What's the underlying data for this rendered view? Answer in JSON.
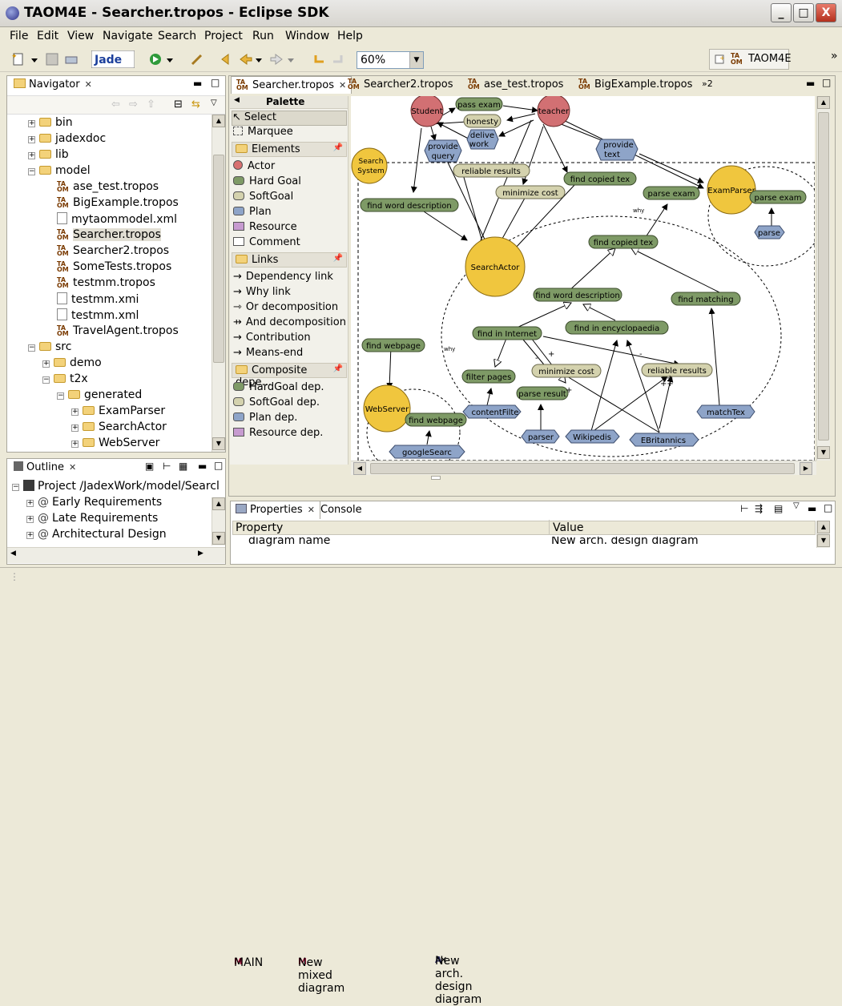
{
  "window": {
    "title": "TAOM4E - Searcher.tropos - Eclipse SDK",
    "min": "_",
    "max": "□",
    "close": "X"
  },
  "menu": [
    "File",
    "Edit",
    "View",
    "Navigate",
    "Search",
    "Project",
    "Run",
    "Window",
    "Help"
  ],
  "toolbar": {
    "zoom": "60%",
    "perspective": "TAOM4E",
    "more": "»"
  },
  "navigator": {
    "title": "Navigator",
    "items": [
      "bin",
      "jadexdoc",
      "lib",
      "model",
      "ase_test.tropos",
      "BigExample.tropos",
      "mytaommodel.xml",
      "Searcher.tropos",
      "Searcher2.tropos",
      "SomeTests.tropos",
      "testmm.tropos",
      "testmm.xmi",
      "testmm.xml",
      "TravelAgent.tropos",
      "src",
      "demo",
      "t2x",
      "generated",
      "ExamParser",
      "SearchActor",
      "WebServer"
    ]
  },
  "outline": {
    "title": "Outline",
    "items": [
      "Project /JadexWork/model/Searcl",
      "Early Requirements",
      "Late Requirements",
      "Architectural Design"
    ]
  },
  "editor_tabs": [
    "Searcher.tropos",
    "Searcher2.tropos",
    "ase_test.tropos",
    "BigExample.tropos",
    "»2"
  ],
  "palette": {
    "title": "Palette",
    "tools": [
      "Select",
      "Marquee"
    ],
    "sections": [
      {
        "name": "Elements",
        "items": [
          "Actor",
          "Hard Goal",
          "SoftGoal",
          "Plan",
          "Resource",
          "Comment"
        ]
      },
      {
        "name": "Links",
        "items": [
          "Dependency link",
          "Why link",
          "Or decomposition",
          "And decomposition",
          "Contribution",
          "Means-end"
        ]
      },
      {
        "name": "Composite depe...",
        "items": [
          "HardGoal dep.",
          "SoftGoal dep.",
          "Plan dep.",
          "Resource dep."
        ]
      }
    ]
  },
  "diagram": {
    "actors": [
      "Student",
      "teacher",
      "Search System",
      "SearchActor",
      "ExamParser",
      "WebServer"
    ],
    "goals": [
      "pass exam",
      "find word description",
      "find copied tex",
      "parse exam",
      "find copied tex",
      "find word description",
      "find matching",
      "find in Internet",
      "find in encyclopaedia",
      "find webpage",
      "filter pages",
      "parse result",
      "find webpage",
      "parse exam"
    ],
    "softgoals": [
      "honesty",
      "reliable results",
      "minimize cost",
      "minimize cost",
      "reliable results"
    ],
    "plans": [
      "provide query",
      "deliver work",
      "provide text",
      "parse",
      "contentFilte",
      "parser",
      "Wikipedia",
      "EBritannica",
      "matchTex",
      "googleSearc"
    ],
    "labels": [
      "why",
      "why",
      "-",
      "+",
      "+",
      "++",
      "+",
      "-"
    ]
  },
  "bottom_tabs": [
    "MAIN",
    "New mixed diagram",
    "New arch. design diagram"
  ],
  "properties": {
    "tabs": [
      "Properties",
      "Console"
    ],
    "headers": [
      "Property",
      "Value"
    ],
    "rows": [
      [
        "diagram name",
        "New arch. design diagram"
      ]
    ]
  }
}
